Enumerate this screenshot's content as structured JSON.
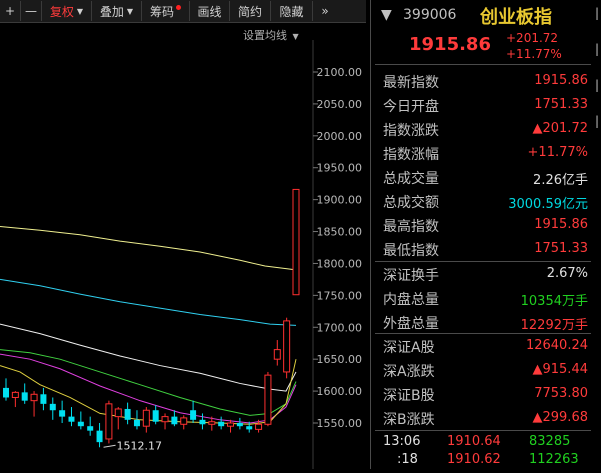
{
  "toolbar": {
    "plus": "+",
    "minus": "—",
    "fuquan": "复权",
    "overlay": "叠加",
    "chips": "筹码",
    "draw": "画线",
    "simple": "简约",
    "hide": "隐藏",
    "expand": "»"
  },
  "chart_header": {
    "set_ma": "设置均线"
  },
  "chart_data": {
    "type": "candlestick",
    "ylim": [
      1500,
      2130
    ],
    "y_ticks": [
      "2100.00",
      "2050.00",
      "2000.00",
      "1950.00",
      "1900.00",
      "1850.00",
      "1800.00",
      "1750.00",
      "1700.00",
      "1650.00",
      "1600.00",
      "1550.00"
    ],
    "low_annotation": "1512.17",
    "candles": [
      {
        "o": 1605,
        "h": 1620,
        "l": 1585,
        "c": 1590
      },
      {
        "o": 1590,
        "h": 1600,
        "l": 1575,
        "c": 1598
      },
      {
        "o": 1598,
        "h": 1612,
        "l": 1580,
        "c": 1585
      },
      {
        "o": 1585,
        "h": 1600,
        "l": 1560,
        "c": 1595
      },
      {
        "o": 1595,
        "h": 1605,
        "l": 1570,
        "c": 1580
      },
      {
        "o": 1580,
        "h": 1590,
        "l": 1555,
        "c": 1570
      },
      {
        "o": 1570,
        "h": 1585,
        "l": 1550,
        "c": 1560
      },
      {
        "o": 1560,
        "h": 1575,
        "l": 1545,
        "c": 1552
      },
      {
        "o": 1552,
        "h": 1568,
        "l": 1540,
        "c": 1545
      },
      {
        "o": 1545,
        "h": 1560,
        "l": 1530,
        "c": 1538
      },
      {
        "o": 1538,
        "h": 1550,
        "l": 1512,
        "c": 1520
      },
      {
        "o": 1525,
        "h": 1585,
        "l": 1518,
        "c": 1580
      },
      {
        "o": 1560,
        "h": 1575,
        "l": 1540,
        "c": 1572
      },
      {
        "o": 1572,
        "h": 1582,
        "l": 1548,
        "c": 1555
      },
      {
        "o": 1555,
        "h": 1570,
        "l": 1540,
        "c": 1545
      },
      {
        "o": 1545,
        "h": 1575,
        "l": 1535,
        "c": 1570
      },
      {
        "o": 1570,
        "h": 1578,
        "l": 1548,
        "c": 1552
      },
      {
        "o": 1552,
        "h": 1565,
        "l": 1540,
        "c": 1560
      },
      {
        "o": 1560,
        "h": 1570,
        "l": 1545,
        "c": 1548
      },
      {
        "o": 1548,
        "h": 1562,
        "l": 1540,
        "c": 1558
      },
      {
        "o": 1570,
        "h": 1585,
        "l": 1550,
        "c": 1555
      },
      {
        "o": 1555,
        "h": 1565,
        "l": 1540,
        "c": 1548
      },
      {
        "o": 1548,
        "h": 1560,
        "l": 1538,
        "c": 1552
      },
      {
        "o": 1552,
        "h": 1560,
        "l": 1540,
        "c": 1545
      },
      {
        "o": 1545,
        "h": 1555,
        "l": 1535,
        "c": 1550
      },
      {
        "o": 1550,
        "h": 1558,
        "l": 1540,
        "c": 1545
      },
      {
        "o": 1545,
        "h": 1552,
        "l": 1535,
        "c": 1540
      },
      {
        "o": 1540,
        "h": 1555,
        "l": 1535,
        "c": 1548
      },
      {
        "o": 1548,
        "h": 1630,
        "l": 1545,
        "c": 1625
      },
      {
        "o": 1650,
        "h": 1680,
        "l": 1640,
        "c": 1665
      },
      {
        "o": 1630,
        "h": 1715,
        "l": 1620,
        "c": 1710
      },
      {
        "o": 1751,
        "h": 1916,
        "l": 1751,
        "c": 1916
      }
    ],
    "ma_lines": [
      {
        "color": "#f0f090",
        "points": [
          [
            0,
            1858
          ],
          [
            40,
            1852
          ],
          [
            80,
            1845
          ],
          [
            120,
            1835
          ],
          [
            160,
            1827
          ],
          [
            200,
            1818
          ],
          [
            240,
            1805
          ],
          [
            265,
            1796
          ],
          [
            296,
            1790
          ]
        ]
      },
      {
        "color": "#30d0f0",
        "points": [
          [
            0,
            1775
          ],
          [
            40,
            1765
          ],
          [
            80,
            1752
          ],
          [
            120,
            1740
          ],
          [
            160,
            1730
          ],
          [
            200,
            1720
          ],
          [
            240,
            1712
          ],
          [
            270,
            1705
          ],
          [
            296,
            1703
          ]
        ]
      },
      {
        "color": "#f0f0f0",
        "points": [
          [
            0,
            1705
          ],
          [
            40,
            1690
          ],
          [
            80,
            1672
          ],
          [
            120,
            1655
          ],
          [
            160,
            1640
          ],
          [
            200,
            1628
          ],
          [
            240,
            1612
          ],
          [
            270,
            1603
          ],
          [
            286,
            1600
          ],
          [
            296,
            1630
          ]
        ]
      },
      {
        "color": "#40d040",
        "points": [
          [
            0,
            1665
          ],
          [
            30,
            1660
          ],
          [
            60,
            1650
          ],
          [
            100,
            1630
          ],
          [
            140,
            1610
          ],
          [
            180,
            1590
          ],
          [
            220,
            1572
          ],
          [
            250,
            1562
          ],
          [
            270,
            1565
          ],
          [
            286,
            1580
          ],
          [
            296,
            1615
          ]
        ]
      },
      {
        "color": "#e040e0",
        "points": [
          [
            0,
            1658
          ],
          [
            30,
            1650
          ],
          [
            60,
            1635
          ],
          [
            100,
            1608
          ],
          [
            140,
            1585
          ],
          [
            180,
            1566
          ],
          [
            220,
            1555
          ],
          [
            250,
            1550
          ],
          [
            270,
            1555
          ],
          [
            286,
            1575
          ],
          [
            296,
            1610
          ]
        ]
      },
      {
        "color": "#e0d040",
        "points": [
          [
            0,
            1640
          ],
          [
            20,
            1630
          ],
          [
            40,
            1610
          ],
          [
            70,
            1590
          ],
          [
            100,
            1565
          ],
          [
            140,
            1555
          ],
          [
            180,
            1552
          ],
          [
            220,
            1550
          ],
          [
            250,
            1548
          ],
          [
            270,
            1552
          ],
          [
            286,
            1580
          ],
          [
            296,
            1650
          ]
        ]
      }
    ]
  },
  "quote": {
    "icon": "▼",
    "code": "399006",
    "name": "创业板指",
    "price": "1915.86",
    "change": "+201.72",
    "change_pct": "+11.77%",
    "rows1": [
      {
        "label": "最新指数",
        "value": "1915.86",
        "color": "red"
      },
      {
        "label": "今日开盘",
        "value": "1751.33",
        "color": "red"
      },
      {
        "label": "指数涨跌",
        "value": "▲201.72",
        "color": "red"
      },
      {
        "label": "指数涨幅",
        "value": "+11.77%",
        "color": "red"
      },
      {
        "label": "总成交量",
        "value": "2.26亿手",
        "color": "white"
      },
      {
        "label": "总成交额",
        "value": "3000.59亿元",
        "color": "cyan"
      },
      {
        "label": "最高指数",
        "value": "1915.86",
        "color": "red"
      },
      {
        "label": "最低指数",
        "value": "1751.33",
        "color": "red"
      }
    ],
    "rows2": [
      {
        "label": "深证换手",
        "value": "2.67%",
        "color": "white"
      },
      {
        "label": "内盘总量",
        "value": "10354万手",
        "color": "green"
      },
      {
        "label": "外盘总量",
        "value": "12292万手",
        "color": "red"
      }
    ],
    "rows3": [
      {
        "label": "深证A股",
        "value": "12640.24",
        "color": "red"
      },
      {
        "label": "深A涨跌",
        "value": "▲915.44",
        "color": "red"
      },
      {
        "label": "深证B股",
        "value": "7753.80",
        "color": "red"
      },
      {
        "label": "深B涨跌",
        "value": "▲299.68",
        "color": "red"
      }
    ],
    "ticks": [
      {
        "time": "13:06",
        "price": "1910.64",
        "vol": "83285"
      },
      {
        "time": ":18",
        "price": "1910.62",
        "vol": "112263"
      }
    ]
  }
}
